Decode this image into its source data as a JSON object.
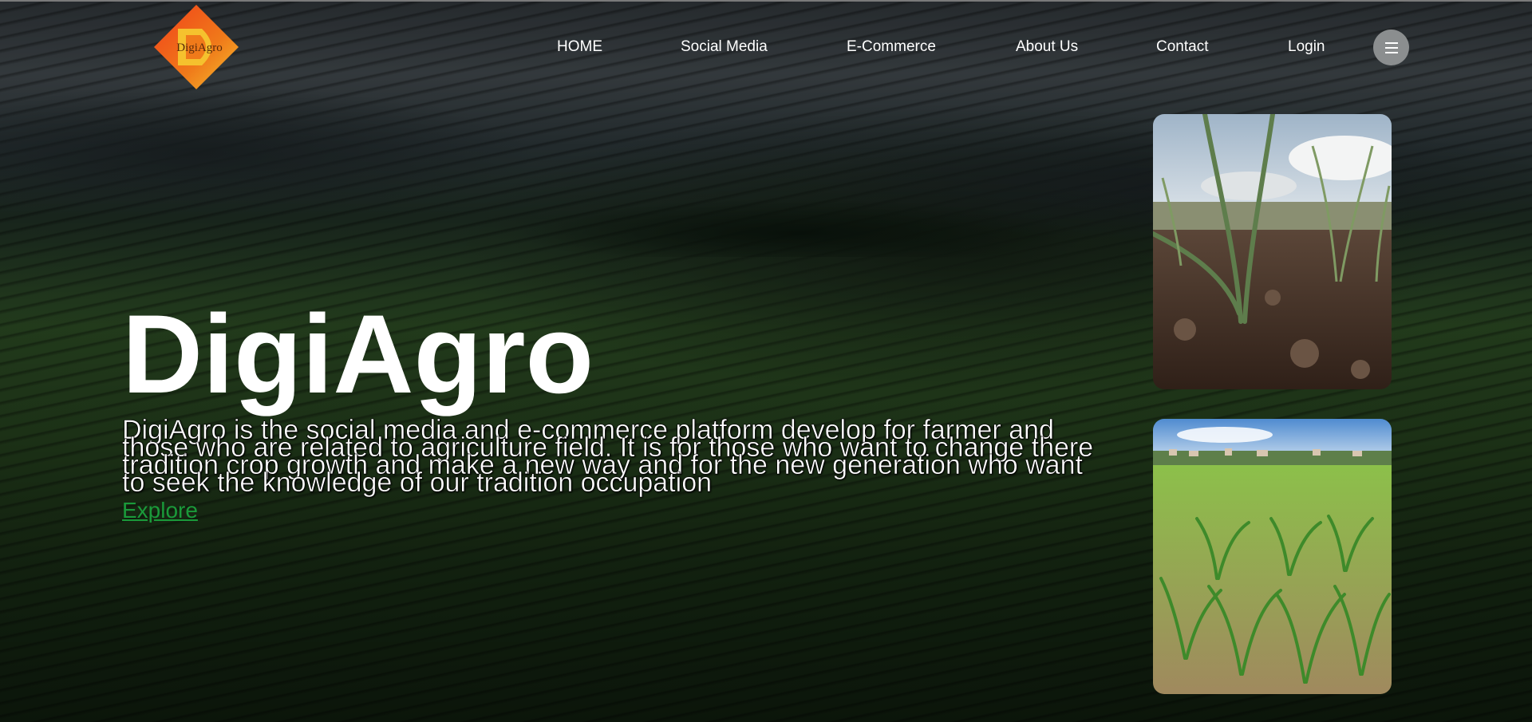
{
  "brand": {
    "logo_text": "DigiAgro",
    "logo_colors": {
      "outer": "#e8521c",
      "inner": "#f5c12e"
    }
  },
  "nav": {
    "items": [
      {
        "label": "HOME"
      },
      {
        "label": "Social Media"
      },
      {
        "label": "E-Commerce"
      },
      {
        "label": "About Us"
      },
      {
        "label": "Contact"
      },
      {
        "label": "Login"
      }
    ],
    "menu_icon": "hamburger-menu-icon"
  },
  "hero": {
    "title": "DigiAgro",
    "description": "DigiAgro is the social media and e-commerce platform develop for farmer and those who are related to agriculture field. It is for those who want to change there tradition crop growth and make a new way and for the new generation who want to seek the knowledge of our tradition occupation",
    "cta_label": "Explore",
    "cta_color": "#1a9a3a"
  },
  "gallery": {
    "images": [
      {
        "subject": "garlic-sprouts-in-soil-photo"
      },
      {
        "subject": "young-corn-field-photo"
      }
    ]
  },
  "colors": {
    "text": "#ffffff",
    "menu_button": "#8b8e8f"
  }
}
